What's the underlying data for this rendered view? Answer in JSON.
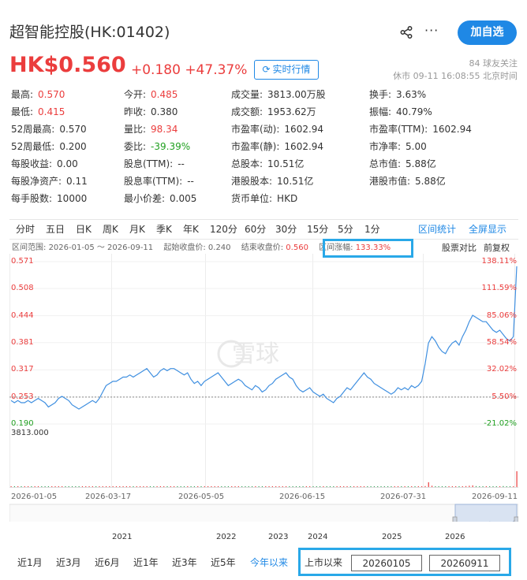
{
  "header": {
    "title": "超智能控股(HK:01402)",
    "add_button": "加自选",
    "price": "HK$0.560",
    "change": "+0.180 +47.37%",
    "realtime_button": "实时行情",
    "followers": "84 球友关注",
    "status": "休市 09-11 16:08:55 北京时间"
  },
  "quote": {
    "col1": [
      {
        "label": "最高:",
        "value": "0.570",
        "tone": "red"
      },
      {
        "label": "最低:",
        "value": "0.415",
        "tone": "red"
      },
      {
        "label": "52周最高:",
        "value": "0.570",
        "tone": "black"
      },
      {
        "label": "52周最低:",
        "value": "0.200",
        "tone": "black"
      },
      {
        "label": "每股收益:",
        "value": "0.00",
        "tone": "black"
      },
      {
        "label": "每股净资产:",
        "value": "0.11",
        "tone": "black"
      },
      {
        "label": "每手股数:",
        "value": "10000",
        "tone": "black"
      }
    ],
    "col2": [
      {
        "label": "今开:",
        "value": "0.485",
        "tone": "red"
      },
      {
        "label": "昨收:",
        "value": "0.380",
        "tone": "black"
      },
      {
        "label": "量比:",
        "value": "98.34",
        "tone": "red"
      },
      {
        "label": "委比:",
        "value": "-39.39%",
        "tone": "green"
      },
      {
        "label": "股息(TTM):",
        "value": "--",
        "tone": "black"
      },
      {
        "label": "股息率(TTM):",
        "value": "--",
        "tone": "black"
      },
      {
        "label": "最小价差:",
        "value": "0.005",
        "tone": "black"
      }
    ],
    "col3": [
      {
        "label": "成交量:",
        "value": "3813.00万股",
        "tone": "black"
      },
      {
        "label": "成交额:",
        "value": "1953.62万",
        "tone": "black"
      },
      {
        "label": "市盈率(动):",
        "value": "1602.94",
        "tone": "black"
      },
      {
        "label": "市盈率(静):",
        "value": "1602.94",
        "tone": "black"
      },
      {
        "label": "总股本:",
        "value": "10.51亿",
        "tone": "black"
      },
      {
        "label": "港股股本:",
        "value": "10.51亿",
        "tone": "black"
      },
      {
        "label": "货币单位:",
        "value": "HKD",
        "tone": "black"
      }
    ],
    "col4": [
      {
        "label": "换手:",
        "value": "3.63%",
        "tone": "black"
      },
      {
        "label": "振幅:",
        "value": "40.79%",
        "tone": "black"
      },
      {
        "label": "市盈率(TTM):",
        "value": "1602.94",
        "tone": "black"
      },
      {
        "label": "市净率:",
        "value": "5.00",
        "tone": "black"
      },
      {
        "label": "总市值:",
        "value": "5.88亿",
        "tone": "black"
      },
      {
        "label": "港股市值:",
        "value": "5.88亿",
        "tone": "black"
      }
    ]
  },
  "periods": [
    "分时",
    "五日",
    "日K",
    "周K",
    "月K",
    "季K",
    "年K",
    "120分",
    "60分",
    "30分",
    "15分",
    "5分",
    "1分"
  ],
  "period_links": {
    "stats": "区间统计",
    "fullscreen": "全屏显示"
  },
  "range": {
    "label": "区间范围:",
    "value": "2026-01-05 ～ 2026-09-11",
    "start_label": "起始收盘价:",
    "start_value": "0.240",
    "end_label": "结束收盘价:",
    "end_value": "0.560",
    "change_label": "区间涨幅:",
    "change_value": "133.33%",
    "compare": "股票对比",
    "adjust": "前复权"
  },
  "chart_data": {
    "type": "line",
    "title": "",
    "xlabel": "",
    "ylabel": "",
    "ylim": [
      0.19,
      0.571
    ],
    "y_ticks": [
      "0.571",
      "0.508",
      "0.444",
      "0.381",
      "0.317",
      "0.253",
      "0.190"
    ],
    "y_pct_ticks": [
      "138.11%",
      "111.59%",
      "85.06%",
      "58.54%",
      "32.02%",
      "5.50%",
      "-21.02%"
    ],
    "volume_label": "3813.000",
    "x_ticks": [
      "2026-01-05",
      "2026-03-17",
      "2026-05-05",
      "2026-06-15",
      "2026-07-31",
      "2026-09-11"
    ],
    "baseline": 0.253,
    "series": [
      {
        "values": [
          0.245,
          0.24,
          0.245,
          0.24,
          0.24,
          0.245,
          0.24,
          0.245,
          0.25,
          0.245,
          0.24,
          0.23,
          0.235,
          0.24,
          0.25,
          0.255,
          0.25,
          0.245,
          0.235,
          0.23,
          0.225,
          0.23,
          0.235,
          0.24,
          0.245,
          0.24,
          0.25,
          0.265,
          0.28,
          0.285,
          0.29,
          0.29,
          0.295,
          0.3,
          0.3,
          0.305,
          0.3,
          0.305,
          0.31,
          0.315,
          0.32,
          0.31,
          0.3,
          0.305,
          0.315,
          0.32,
          0.315,
          0.32,
          0.32,
          0.315,
          0.31,
          0.305,
          0.31,
          0.295,
          0.285,
          0.29,
          0.28,
          0.29,
          0.295,
          0.3,
          0.305,
          0.31,
          0.3,
          0.29,
          0.28,
          0.285,
          0.29,
          0.295,
          0.29,
          0.28,
          0.275,
          0.27,
          0.28,
          0.275,
          0.265,
          0.27,
          0.28,
          0.285,
          0.295,
          0.3,
          0.305,
          0.31,
          0.3,
          0.295,
          0.28,
          0.27,
          0.265,
          0.27,
          0.275,
          0.265,
          0.26,
          0.255,
          0.26,
          0.25,
          0.245,
          0.24,
          0.25,
          0.255,
          0.265,
          0.275,
          0.27,
          0.28,
          0.29,
          0.3,
          0.31,
          0.3,
          0.295,
          0.285,
          0.28,
          0.275,
          0.27,
          0.265,
          0.26,
          0.265,
          0.275,
          0.27,
          0.275,
          0.27,
          0.28,
          0.275,
          0.28,
          0.29,
          0.33,
          0.38,
          0.395,
          0.385,
          0.37,
          0.36,
          0.355,
          0.37,
          0.38,
          0.385,
          0.375,
          0.395,
          0.41,
          0.43,
          0.445,
          0.44,
          0.435,
          0.43,
          0.43,
          0.42,
          0.41,
          0.405,
          0.41,
          0.4,
          0.39,
          0.385,
          0.395,
          0.56
        ]
      }
    ],
    "volume": [
      0.02,
      0.03,
      0.02,
      0.02,
      0.03,
      0.02,
      0.04,
      0.02,
      0.03,
      0.02,
      0.02,
      0.03,
      0.02,
      0.02,
      0.02,
      0.03,
      0.02,
      0.02,
      0.03,
      0.02,
      0.02,
      0.02,
      0.03,
      0.02,
      0.02,
      0.03,
      0.04,
      0.03,
      0.02,
      0.02,
      0.03,
      0.02,
      0.02,
      0.02,
      0.03,
      0.02,
      0.02,
      0.02,
      0.03,
      0.02,
      0.02,
      0.02,
      0.02,
      0.03,
      0.02,
      0.02,
      0.02,
      0.02,
      0.03,
      0.02,
      0.02,
      0.02,
      0.02,
      0.02,
      0.03,
      0.02,
      0.02,
      0.02,
      0.02,
      0.02,
      0.03,
      0.02,
      0.02,
      0.02,
      0.02,
      0.02,
      0.02,
      0.03,
      0.02,
      0.02,
      0.02,
      0.02,
      0.02,
      0.02,
      0.02,
      0.03,
      0.02,
      0.02,
      0.02,
      0.02,
      0.02,
      0.02,
      0.02,
      0.02,
      0.02,
      0.03,
      0.02,
      0.02,
      0.02,
      0.02,
      0.02,
      0.02,
      0.02,
      0.02,
      0.02,
      0.02,
      0.02,
      0.03,
      0.02,
      0.02,
      0.02,
      0.02,
      0.02,
      0.03,
      0.02,
      0.02,
      0.02,
      0.02,
      0.02,
      0.02,
      0.02,
      0.02,
      0.02,
      0.03,
      0.02,
      0.02,
      0.02,
      0.02,
      0.02,
      0.02,
      0.03,
      0.02,
      0.06,
      0.3,
      0.08,
      0.05,
      0.04,
      0.03,
      0.04,
      0.05,
      0.03,
      0.04,
      0.03,
      0.05,
      0.06,
      0.08,
      0.1,
      0.06,
      0.05,
      0.04,
      0.03,
      0.04,
      0.05,
      0.03,
      0.04,
      0.06,
      0.05,
      0.04,
      0.05,
      1.0
    ],
    "navigator_years": [
      "2021",
      "2022",
      "2023",
      "2024",
      "2025",
      "2026"
    ]
  },
  "bottom": {
    "periods": [
      "近1月",
      "近3月",
      "近6月",
      "近1年",
      "近3年",
      "近5年",
      "今年以来",
      "上市以来"
    ],
    "start_date": "20260105",
    "end_date": "20260911"
  },
  "colors": {
    "accent": "#1f88e5",
    "up": "#eb3d3d",
    "down": "#20a020",
    "line": "#3f8fe0",
    "highlight": "#29a8e8"
  }
}
